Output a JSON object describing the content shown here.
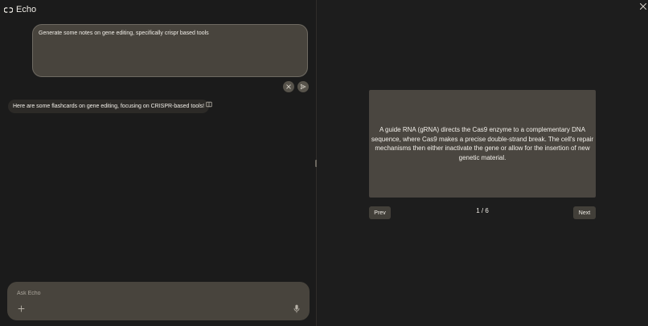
{
  "app": {
    "name": "Echo",
    "logo_icon": "echo-logo-icon"
  },
  "chat": {
    "user_prompt": "Generate some notes on gene editing, specifically crispr based tools",
    "ai_reply": "Here are some flashcards on gene editing, focusing on CRISPR-based tools!"
  },
  "composer": {
    "placeholder": "Ask Echo"
  },
  "flashcards": {
    "current_text": "A guide RNA (gRNA) directs the Cas9 enzyme to a complementary DNA sequence, where Cas9 makes a precise double-strand break. The cell's repair mechanisms then either inactivate the gene or allow for the insertion of new genetic material.",
    "counter": "1 / 6",
    "prev_label": "Prev",
    "next_label": "Next"
  },
  "colors": {
    "background": "#1b1b1b",
    "panel": "#48443d",
    "card": "#4a4640",
    "text": "#f1eee8"
  }
}
